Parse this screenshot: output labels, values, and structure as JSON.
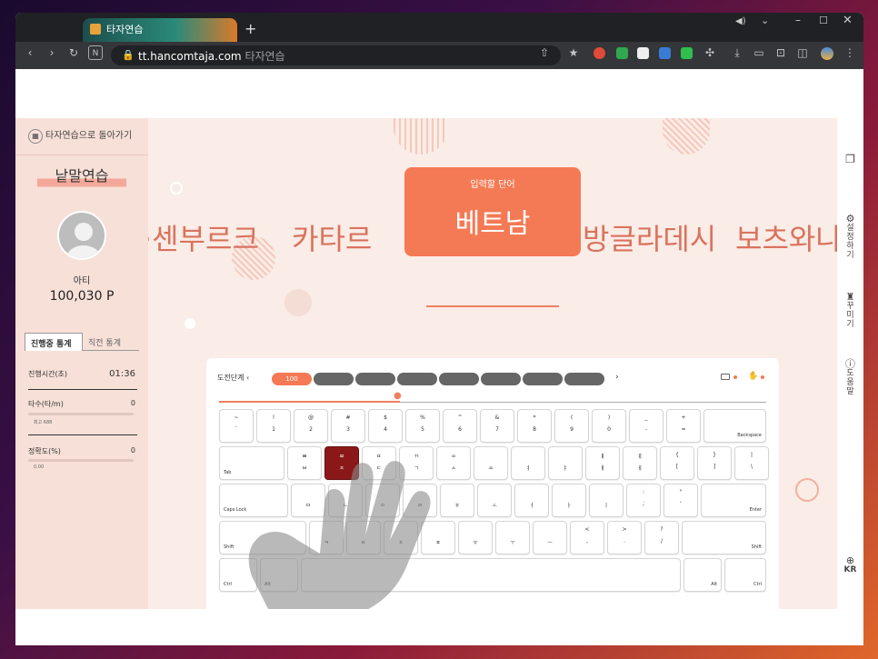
{
  "browser": {
    "tab_title": "타자연습",
    "url_domain": "tt.hancomtaja.com",
    "url_title": "타자연습"
  },
  "sidebar": {
    "back_label": "타자연습으로 돌아가기",
    "title": "낱말연습",
    "user_name": "아티",
    "points": "100,030 P",
    "tabs": [
      "진행중 통계",
      "직전 통계"
    ],
    "stats": [
      {
        "label": "진행시간(초)",
        "value": "01:36"
      },
      {
        "label": "타수(타/m)",
        "value": "0",
        "sub": "최고 688"
      },
      {
        "label": "정확도(%)",
        "value": "0",
        "sub": "0.00"
      }
    ]
  },
  "main": {
    "words_left": "·센부르크",
    "word_prev": "카타르",
    "card_label": "입력할 단어",
    "current_word": "베트남",
    "word_next1": "방글라데시",
    "word_next2": "보츠와나",
    "stage_label": "도전단계",
    "stage_value": "100",
    "progress": 0.33
  },
  "rail": [
    {
      "label": "설정하기"
    },
    {
      "label": "꾸미기"
    },
    {
      "label": "도움말"
    },
    {
      "label": "KR"
    }
  ],
  "keyboard": {
    "row1": [
      [
        "~",
        "`"
      ],
      [
        "!",
        "1"
      ],
      [
        "@",
        "2"
      ],
      [
        "#",
        "3"
      ],
      [
        "$",
        "4"
      ],
      [
        "%",
        "5"
      ],
      [
        "^",
        "6"
      ],
      [
        "&",
        "7"
      ],
      [
        "*",
        "8"
      ],
      [
        "(",
        "9"
      ],
      [
        ")",
        "0"
      ],
      [
        "_",
        "-"
      ],
      [
        "+",
        "="
      ]
    ],
    "backspace": "Backspace",
    "tab": "Tab",
    "row2": [
      [
        "ㅃ",
        "ㅂ"
      ],
      [
        "ㅉ",
        "ㅈ"
      ],
      [
        "ㄸ",
        "ㄷ"
      ],
      [
        "ㄲ",
        "ㄱ"
      ],
      [
        "ㅆ",
        "ㅅ"
      ],
      [
        "",
        "ㅛ"
      ],
      [
        "",
        "ㅕ"
      ],
      [
        "",
        "ㅑ"
      ],
      [
        "ㅒ",
        "ㅐ"
      ],
      [
        "ㅖ",
        "ㅔ"
      ],
      [
        "{",
        "["
      ],
      [
        "}",
        "]"
      ],
      [
        "|",
        "\\"
      ]
    ],
    "capslock": "Caps Lock",
    "row3": [
      [
        "",
        "ㅁ"
      ],
      [
        "",
        "ㄴ"
      ],
      [
        "",
        "ㅇ"
      ],
      [
        "",
        "ㄹ"
      ],
      [
        "",
        "ㅎ"
      ],
      [
        "",
        "ㅗ"
      ],
      [
        "",
        "ㅓ"
      ],
      [
        "",
        "ㅏ"
      ],
      [
        "",
        "ㅣ"
      ],
      [
        ":",
        ";"
      ],
      [
        "\"",
        "'"
      ]
    ],
    "enter": "Enter",
    "shift": "Shift",
    "row4": [
      [
        "",
        "ㅋ"
      ],
      [
        "",
        "ㅌ"
      ],
      [
        "",
        "ㅊ"
      ],
      [
        "",
        "ㅍ"
      ],
      [
        "",
        "ㅠ"
      ],
      [
        "",
        "ㅜ"
      ],
      [
        "",
        "ㅡ"
      ],
      [
        "<",
        ","
      ],
      [
        ">",
        "."
      ],
      [
        "?",
        "/"
      ]
    ],
    "ctrl": "Ctrl",
    "alt": "Alt"
  },
  "colors": {
    "accent": "#f47a55",
    "highlight_key": "#8b1818"
  }
}
